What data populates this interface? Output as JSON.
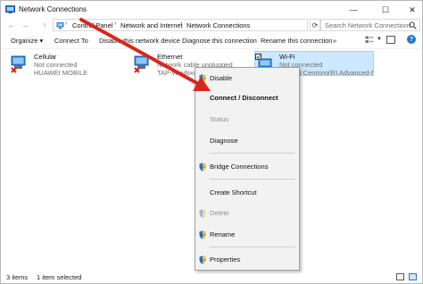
{
  "window": {
    "title": "Network Connections",
    "controls": [
      "—",
      "☐",
      "✕"
    ]
  },
  "address": {
    "back": "←",
    "forward": "→",
    "up": "↑",
    "crumbs": [
      "Control Panel",
      "Network and Internet",
      "Network Connections"
    ],
    "separator": "›",
    "refresh": "⟳",
    "search_placeholder": "Search Network Connections"
  },
  "toolbar": {
    "organize": "Organize ▾",
    "connect_to": "Connect To",
    "disable": "Disable this network device",
    "diagnose": "Diagnose this connection",
    "rename": "Rename this connection",
    "more": "»",
    "dropdown": "▼",
    "help": "?"
  },
  "connections": [
    {
      "name": "Cellular",
      "status": "Not connected",
      "device": "HUAWEI MOBILE"
    },
    {
      "name": "Ethernet",
      "status": "Network cable unplugged",
      "device": "TAP-Windows Adapter V9"
    },
    {
      "name": "Wi-Fi",
      "status": "Not connected",
      "device": "Intel(R) Centrino(R) Advanced-N"
    }
  ],
  "context_menu": [
    {
      "label": "Disable",
      "shield": true,
      "style": "normal"
    },
    {
      "label": "Connect / Disconnect",
      "shield": false,
      "style": "bold"
    },
    {
      "label": "Status",
      "shield": false,
      "style": "disabled"
    },
    {
      "label": "Diagnose",
      "shield": false,
      "style": "normal"
    },
    {
      "label": "Bridge Connections",
      "shield": true,
      "style": "normal"
    },
    {
      "label": "Create Shortcut",
      "shield": false,
      "style": "normal"
    },
    {
      "label": "Delete",
      "shield": true,
      "style": "disabled"
    },
    {
      "label": "Rename",
      "shield": true,
      "style": "normal"
    },
    {
      "label": "Properties",
      "shield": true,
      "style": "normal"
    }
  ],
  "status": {
    "item_count": "3 items",
    "selected": "1 item selected"
  },
  "colors": {
    "annotation_arrow": "#d9261c",
    "selection_fill": "#cce8ff",
    "help_icon": "#1c76d6"
  }
}
